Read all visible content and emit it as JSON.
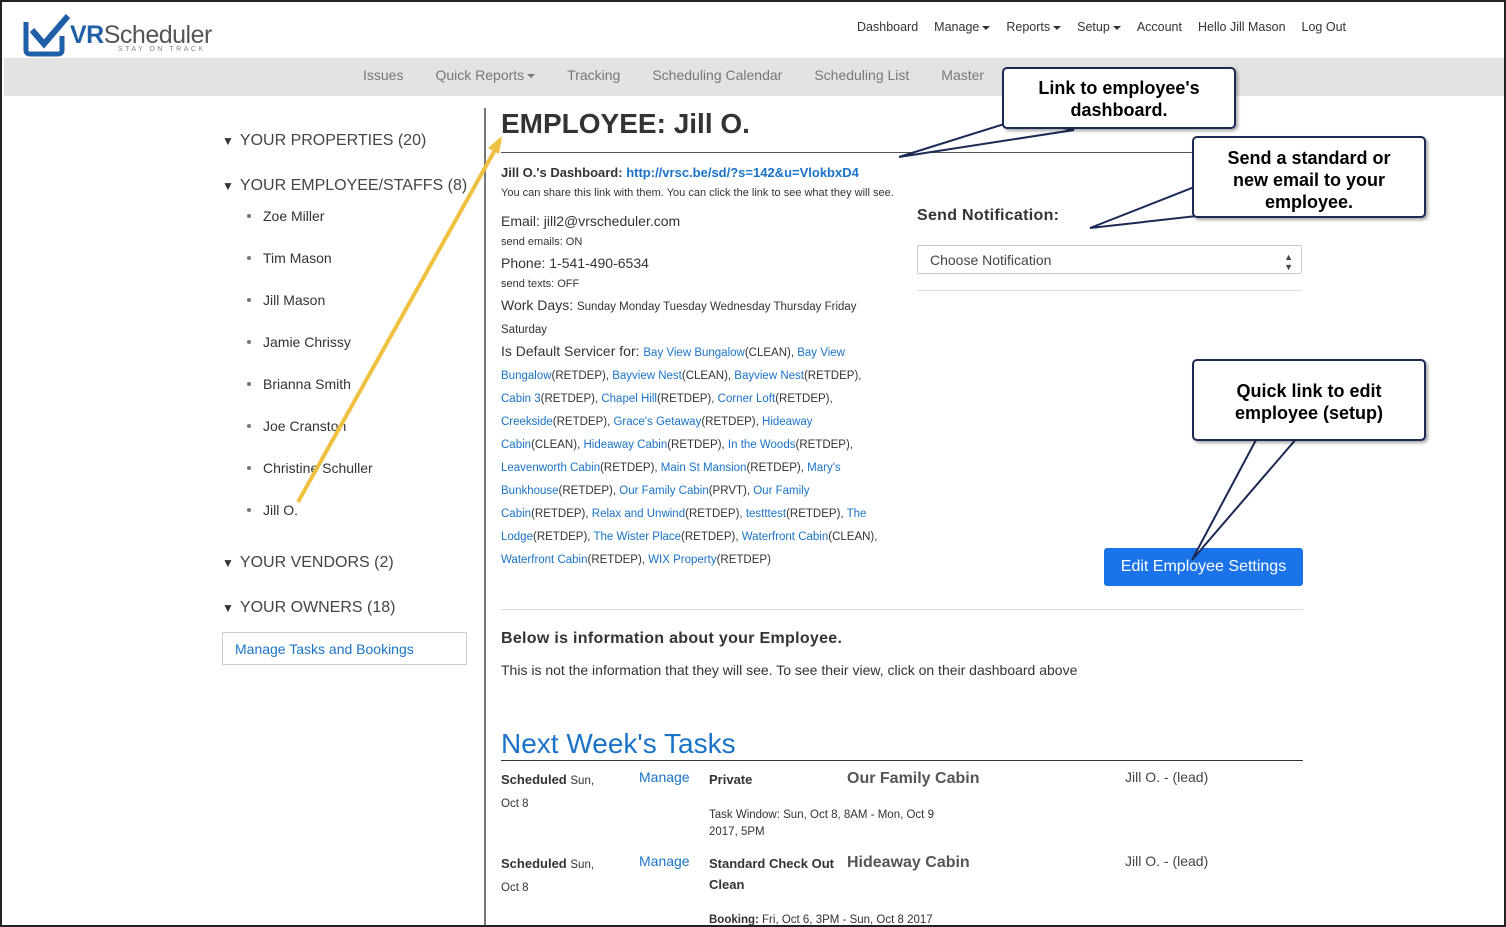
{
  "logo": {
    "brand_prefix": "VR",
    "brand_suffix": "Scheduler",
    "tagline": "STAY ON TRACK"
  },
  "topnav": {
    "dashboard": "Dashboard",
    "manage": "Manage",
    "reports": "Reports",
    "setup": "Setup",
    "account": "Account",
    "greeting": "Hello Jill Mason",
    "logout": "Log Out"
  },
  "subnav": {
    "issues": "Issues",
    "quick_reports": "Quick Reports",
    "tracking": "Tracking",
    "calendar": "Scheduling Calendar",
    "list": "Scheduling List",
    "master": "Master"
  },
  "sidebar": {
    "properties": "YOUR PROPERTIES (20)",
    "staffs": "YOUR EMPLOYEE/STAFFS (8)",
    "staff_items": [
      "Zoe Miller",
      "Tim Mason",
      "Jill Mason",
      "Jamie Chrissy",
      "Brianna Smith",
      "Joe Cranston",
      "Christine Schuller",
      "Jill O."
    ],
    "vendors": "YOUR VENDORS (2)",
    "owners": "YOUR OWNERS (18)",
    "manage_link": "Manage Tasks and Bookings"
  },
  "employee": {
    "title": "EMPLOYEE: Jill O.",
    "dashboard_label": "Jill O.'s Dashboard:",
    "dashboard_url": "http://vrsc.be/sd/?s=142&u=VlokbxD4",
    "dashboard_note": "You can share this link with them. You can click the link to see what they will see.",
    "email_label": "Email:",
    "email": "jill2@vrscheduler.com",
    "send_emails": "send emails: ON",
    "phone_label": "Phone:",
    "phone": "1-541-490-6534",
    "send_texts": "send texts: OFF",
    "workdays_label": "Work Days:",
    "workdays": "Sunday Monday Tuesday Wednesday Thursday Friday Saturday",
    "servicer_label": "Is Default Servicer for:",
    "servicer_items": [
      {
        "name": "Bay View Bungalow",
        "code": "(CLEAN)"
      },
      {
        "name": "Bay View Bungalow",
        "code": "(RETDEP)"
      },
      {
        "name": "Bayview Nest",
        "code": "(CLEAN)"
      },
      {
        "name": "Bayview Nest",
        "code": "(RETDEP)"
      },
      {
        "name": "Cabin 3",
        "code": "(RETDEP)"
      },
      {
        "name": "Chapel Hill",
        "code": "(RETDEP)"
      },
      {
        "name": "Corner Loft",
        "code": "(RETDEP)"
      },
      {
        "name": "Creekside",
        "code": "(RETDEP)"
      },
      {
        "name": "Grace's Getaway",
        "code": "(RETDEP)"
      },
      {
        "name": "Hideaway Cabin",
        "code": "(CLEAN)"
      },
      {
        "name": "Hideaway Cabin",
        "code": "(RETDEP)"
      },
      {
        "name": "In the Woods",
        "code": "(RETDEP)"
      },
      {
        "name": "Leavenworth Cabin",
        "code": "(RETDEP)"
      },
      {
        "name": "Main St Mansion",
        "code": "(RETDEP)"
      },
      {
        "name": "Mary's Bunkhouse",
        "code": "(RETDEP)"
      },
      {
        "name": "Our Family Cabin",
        "code": "(PRVT)"
      },
      {
        "name": "Our Family Cabin",
        "code": "(RETDEP)"
      },
      {
        "name": "Relax and Unwind",
        "code": "(RETDEP)"
      },
      {
        "name": "testttest",
        "code": "(RETDEP)"
      },
      {
        "name": "The Lodge",
        "code": "(RETDEP)"
      },
      {
        "name": "The Wister Place",
        "code": "(RETDEP)"
      },
      {
        "name": "Waterfront Cabin",
        "code": "(CLEAN)"
      },
      {
        "name": "Waterfront Cabin",
        "code": "(RETDEP)"
      },
      {
        "name": "WIX Property",
        "code": "(RETDEP)"
      }
    ]
  },
  "notification": {
    "label": "Send Notification:",
    "select_value": "Choose Notification"
  },
  "edit_button": "Edit Employee Settings",
  "below": {
    "heading": "Below is information about your Employee.",
    "note": "This is not the information that they will see. To see their view, click on their dashboard above"
  },
  "tasks": {
    "heading": "Next Week's Tasks",
    "rows": [
      {
        "status": "Scheduled",
        "date": "Sun, Oct 8",
        "manage": "Manage",
        "type": "Private",
        "property": "Our Family Cabin",
        "assignee": "Jill O. - (lead)",
        "detail_label": "Task Window:",
        "detail": "Sun, Oct 8, 8AM - Mon, Oct 9 2017, 5PM"
      },
      {
        "status": "Scheduled",
        "date": "Sun, Oct 8",
        "manage": "Manage",
        "type": "Standard Check Out Clean",
        "property": "Hideaway Cabin",
        "assignee": "Jill O. - (lead)",
        "detail_label": "Booking:",
        "detail": "Fri, Oct 6, 3PM - Sun, Oct 8 2017"
      }
    ]
  },
  "callouts": {
    "dashboard": "Link to employee's dashboard.",
    "notification": "Send a standard or new email to your employee.",
    "edit": "Quick link to edit employee (setup)"
  },
  "colors": {
    "link": "#1a73c8",
    "button": "#1a73e8",
    "arrow": "#f0c040",
    "callout_border": "#1b2a55"
  }
}
